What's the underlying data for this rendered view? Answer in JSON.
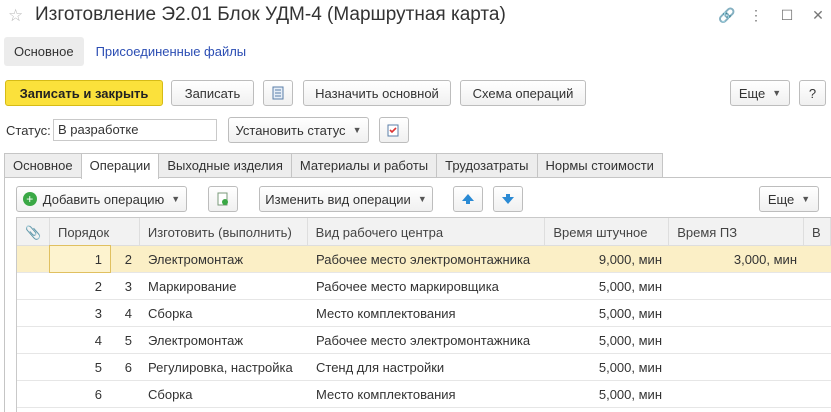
{
  "window": {
    "title": "Изготовление Э2.01 Блок УДМ-4 (Маршрутная карта)"
  },
  "nav": {
    "main_tab": "Основное",
    "files_link": "Присоединенные файлы"
  },
  "toolbar": {
    "save_close": "Записать и закрыть",
    "save": "Записать",
    "set_main": "Назначить основной",
    "ops_scheme": "Схема операций",
    "more": "Еще",
    "help": "?"
  },
  "status": {
    "label": "Статус:",
    "value": "В разработке",
    "set_status": "Установить статус"
  },
  "tabs": [
    "Основное",
    "Операции",
    "Выходные изделия",
    "Материалы и работы",
    "Трудозатраты",
    "Нормы стоимости"
  ],
  "ops_toolbar": {
    "add_operation": "Добавить операцию",
    "change_view": "Изменить вид операции",
    "more": "Еще"
  },
  "grid": {
    "columns": [
      "Порядок",
      "Изготовить (выполнить)",
      "Вид рабочего центра",
      "Время штучное",
      "Время ПЗ",
      "В"
    ],
    "rows": [
      {
        "order": "1",
        "next": "2",
        "make": "Электромонтаж",
        "center": "Рабочее место электромонтажника",
        "time": "9,000, мин",
        "pz": "3,000, мин"
      },
      {
        "order": "2",
        "next": "3",
        "make": "Маркирование",
        "center": "Рабочее место маркировщика",
        "time": "5,000, мин",
        "pz": ""
      },
      {
        "order": "3",
        "next": "4",
        "make": "Сборка",
        "center": "Место комплектования",
        "time": "5,000, мин",
        "pz": ""
      },
      {
        "order": "4",
        "next": "5",
        "make": "Электромонтаж",
        "center": "Рабочее место электромонтажника",
        "time": "5,000, мин",
        "pz": ""
      },
      {
        "order": "5",
        "next": "6",
        "make": "Регулировка, настройка",
        "center": "Стенд для настройки",
        "time": "5,000, мин",
        "pz": ""
      },
      {
        "order": "6",
        "next": "",
        "make": "Сборка",
        "center": "Место комплектования",
        "time": "5,000, мин",
        "pz": ""
      }
    ]
  }
}
